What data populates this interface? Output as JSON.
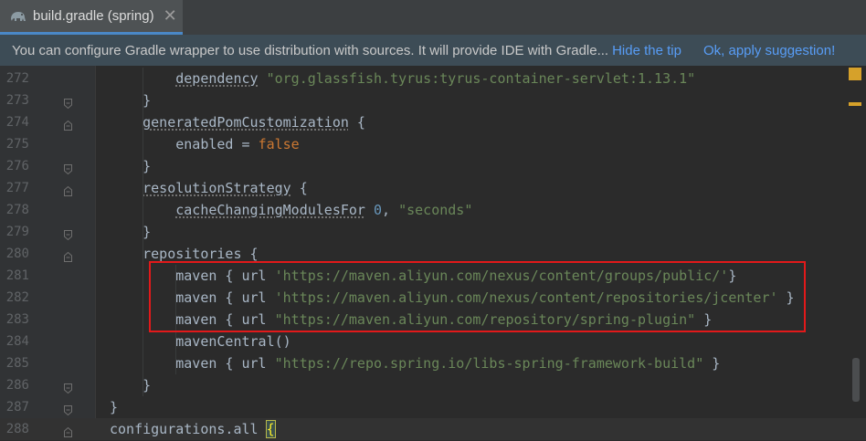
{
  "tab": {
    "label": "build.gradle (spring)",
    "close": "✕",
    "icon": "gradle-elephant-icon"
  },
  "banner": {
    "message": "You can configure Gradle wrapper to use distribution with sources. It will provide IDE with Gradle...",
    "hide_tip": "Hide the tip",
    "apply": "Ok, apply suggestion!"
  },
  "colors": {
    "string": "#6a8759",
    "keyword": "#cc7832",
    "number": "#6897bb",
    "text": "#a9b7c6",
    "highlight_box": "#e2191a"
  },
  "lines": [
    {
      "num": "272",
      "tokens": [
        [
          "    ",
          "p"
        ],
        [
          "dependency",
          "fn"
        ],
        [
          " ",
          "p"
        ],
        [
          "\"org.glassfish.tyrus:tyrus-container-servlet:1.13.1\"",
          "str"
        ]
      ]
    },
    {
      "num": "273",
      "tokens": [
        [
          "  }",
          "p"
        ]
      ]
    },
    {
      "num": "274",
      "tokens": [
        [
          "  ",
          "p"
        ],
        [
          "generatedPomCustomization",
          "fn"
        ],
        [
          " {",
          "p"
        ]
      ]
    },
    {
      "num": "275",
      "tokens": [
        [
          "    enabled = ",
          "p"
        ],
        [
          "false",
          "kw"
        ]
      ]
    },
    {
      "num": "276",
      "tokens": [
        [
          "  }",
          "p"
        ]
      ]
    },
    {
      "num": "277",
      "tokens": [
        [
          "  ",
          "p"
        ],
        [
          "resolutionStrategy",
          "fn"
        ],
        [
          " {",
          "p"
        ]
      ]
    },
    {
      "num": "278",
      "tokens": [
        [
          "    ",
          "p"
        ],
        [
          "cacheChangingModulesFor",
          "fn"
        ],
        [
          " ",
          "p"
        ],
        [
          "0",
          "num"
        ],
        [
          ", ",
          "p"
        ],
        [
          "\"seconds\"",
          "str"
        ]
      ]
    },
    {
      "num": "279",
      "tokens": [
        [
          "  }",
          "p"
        ]
      ]
    },
    {
      "num": "280",
      "tokens": [
        [
          "  repositories {",
          "p"
        ]
      ]
    },
    {
      "num": "281",
      "tokens": [
        [
          "    maven { url ",
          "p"
        ],
        [
          "'https://maven.aliyun.com/nexus/content/groups/public/'",
          "str"
        ],
        [
          "}",
          "p"
        ]
      ]
    },
    {
      "num": "282",
      "tokens": [
        [
          "    maven { url ",
          "p"
        ],
        [
          "'https://maven.aliyun.com/nexus/content/repositories/jcenter'",
          "str"
        ],
        [
          " }",
          "p"
        ]
      ]
    },
    {
      "num": "283",
      "tokens": [
        [
          "    maven { url ",
          "p"
        ],
        [
          "\"https://maven.aliyun.com/repository/spring-plugin\"",
          "str"
        ],
        [
          " }",
          "p"
        ]
      ]
    },
    {
      "num": "284",
      "tokens": [
        [
          "    mavenCentral()",
          "p"
        ]
      ]
    },
    {
      "num": "285",
      "tokens": [
        [
          "    maven { url ",
          "p"
        ],
        [
          "\"https://repo.spring.io/libs-spring-framework-build\"",
          "str"
        ],
        [
          " }",
          "p"
        ]
      ]
    },
    {
      "num": "286",
      "tokens": [
        [
          "  }",
          "p"
        ]
      ]
    },
    {
      "num": "287",
      "tokens": [
        [
          "}",
          "p"
        ]
      ]
    },
    {
      "num": "288",
      "tokens": [
        [
          "configurations.all ",
          "p"
        ],
        [
          "{",
          "brace"
        ]
      ]
    }
  ]
}
